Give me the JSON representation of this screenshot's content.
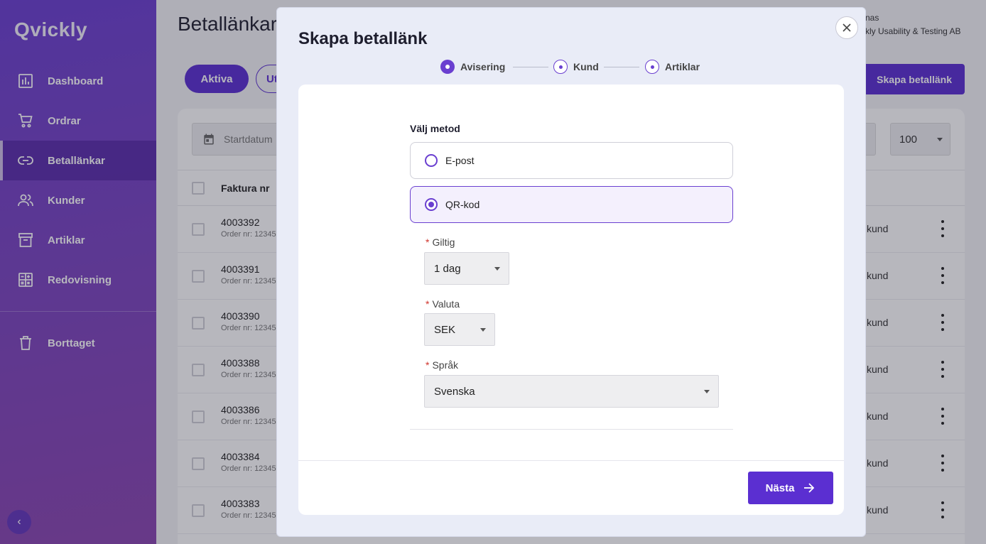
{
  "app": {
    "logo": "Qvickly"
  },
  "sidebar": {
    "items": [
      {
        "label": "Dashboard",
        "icon": "chart-icon"
      },
      {
        "label": "Ordrar",
        "icon": "cart-icon"
      },
      {
        "label": "Betallänkar",
        "icon": "link-icon",
        "active": true
      },
      {
        "label": "Kunder",
        "icon": "people-icon"
      },
      {
        "label": "Artiklar",
        "icon": "archive-icon"
      },
      {
        "label": "Redovisning",
        "icon": "calculator-icon"
      }
    ],
    "bottom_item": {
      "label": "Borttaget",
      "icon": "trash-icon"
    },
    "collapse_icon": "‹"
  },
  "header": {
    "title": "Betallänkar",
    "user_name": "nas",
    "user_org": "kly Usability & Testing AB"
  },
  "toolbar": {
    "tab_active": "Aktiva",
    "tab_other": "Ut",
    "create_label": "Skapa betallänk",
    "date_placeholder": "Startdatum",
    "per_page": "100"
  },
  "table": {
    "column_header": "Faktura nr",
    "rows": [
      {
        "invoice": "4003392",
        "order": "Order nr: 12345",
        "customer": "kund"
      },
      {
        "invoice": "4003391",
        "order": "Order nr: 12345",
        "customer": "kund"
      },
      {
        "invoice": "4003390",
        "order": "Order nr: 12345",
        "customer": "kund"
      },
      {
        "invoice": "4003388",
        "order": "Order nr: 12345",
        "customer": "kund"
      },
      {
        "invoice": "4003386",
        "order": "Order nr: 12345",
        "customer": "kund"
      },
      {
        "invoice": "4003384",
        "order": "Order nr: 12345",
        "customer": "kund"
      },
      {
        "invoice": "4003383",
        "order": "Order nr: 12345",
        "customer": "kund"
      }
    ]
  },
  "modal": {
    "title": "Skapa betallänk",
    "steps": [
      "Avisering",
      "Kund",
      "Artiklar"
    ],
    "method_label": "Välj metod",
    "options": [
      {
        "label": "E-post",
        "selected": false
      },
      {
        "label": "QR-kod",
        "selected": true
      }
    ],
    "fields": {
      "valid_label": "Giltig",
      "valid_value": "1 dag",
      "currency_label": "Valuta",
      "currency_value": "SEK",
      "language_label": "Språk",
      "language_value": "Svenska"
    },
    "next_label": "Nästa"
  },
  "colors": {
    "accent": "#5b2fd1",
    "sidebar_top": "#6a3fd0",
    "sidebar_bottom": "#8a46b0",
    "required": "#d0342c"
  }
}
